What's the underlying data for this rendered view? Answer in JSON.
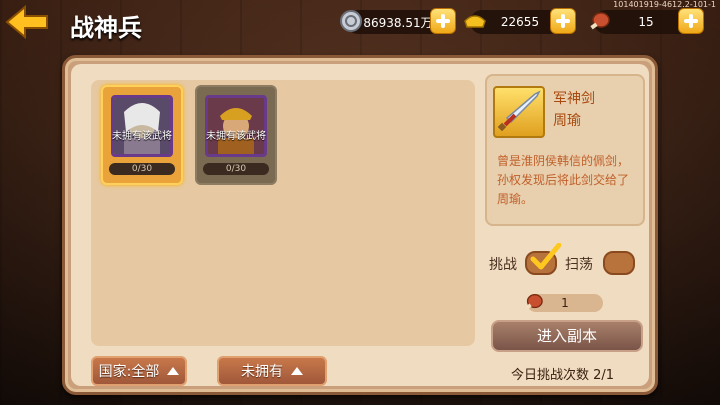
{
  "header": {
    "title": "战神兵",
    "build_info": "101401919-4612.2-101-1"
  },
  "resources": {
    "silver": "86938.51万",
    "gold": "22655",
    "stamina": "15"
  },
  "cards": [
    {
      "lock_text": "未拥有该武将",
      "progress": "0/30",
      "selected": true
    },
    {
      "lock_text": "未拥有该武将",
      "progress": "0/30",
      "selected": false
    }
  ],
  "filters": {
    "country": "国家:全部",
    "ownership": "未拥有"
  },
  "weapon": {
    "name": "军神剑",
    "owner": "周瑜",
    "description": "曾是淮阴侯韩信的佩剑，孙权发现后将此剑交给了周瑜。"
  },
  "modes": {
    "challenge_label": "挑战",
    "sweep_label": "扫荡",
    "challenge_checked": true,
    "sweep_checked": false
  },
  "cost": "1",
  "enter_button": "进入副本",
  "daily_challenges": "今日挑战次数 2/1",
  "colors": {
    "accent_orange": "#e9a33a",
    "panel_bg": "#f0dcc0",
    "text_red": "#a84a10"
  }
}
